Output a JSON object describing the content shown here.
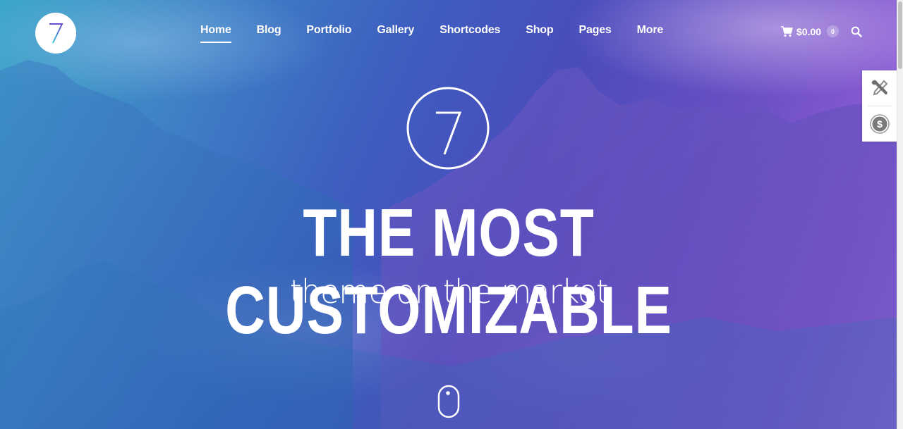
{
  "header": {
    "logo_glyph": "7",
    "nav": [
      {
        "label": "Home",
        "active": true
      },
      {
        "label": "Blog"
      },
      {
        "label": "Portfolio"
      },
      {
        "label": "Gallery"
      },
      {
        "label": "Shortcodes"
      },
      {
        "label": "Shop"
      },
      {
        "label": "Pages"
      },
      {
        "label": "More"
      }
    ],
    "cart": {
      "icon": "cart-icon",
      "total": "$0.00",
      "count": "0"
    },
    "search_icon": "search-icon"
  },
  "side_panel": {
    "items": [
      {
        "icon": "tools-icon",
        "label": "Customize"
      },
      {
        "icon": "dollar-icon",
        "label": "Purchase"
      }
    ]
  },
  "hero": {
    "badge_glyph": "7",
    "headline": "THE MOST CUSTOMIZABLE",
    "subheadline": "theme on the market",
    "scroll_icon": "mouse-scroll-icon"
  },
  "colors": {
    "gradient_start": "#3aa6c9",
    "gradient_mid": "#4a4cbc",
    "gradient_end": "#b27ee6",
    "text": "#ffffff",
    "side_icon": "#7a7a7a"
  }
}
